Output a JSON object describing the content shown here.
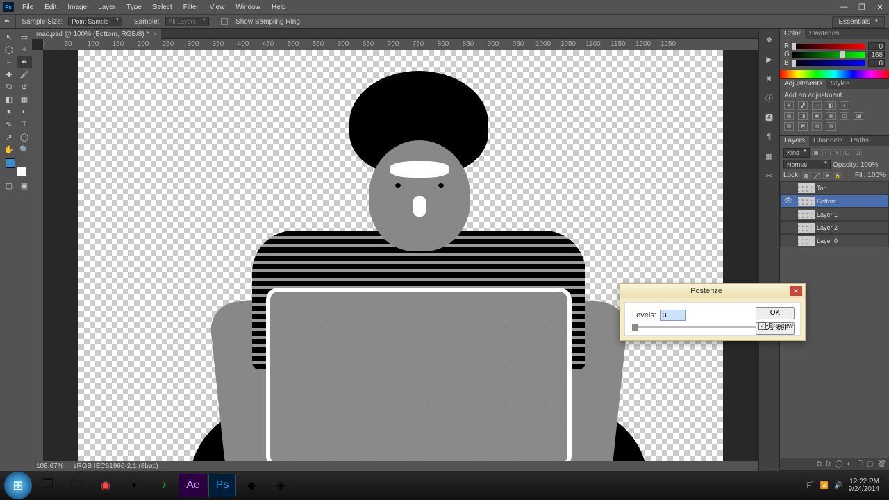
{
  "menu": {
    "items": [
      "File",
      "Edit",
      "Image",
      "Layer",
      "Type",
      "Select",
      "Filter",
      "View",
      "Window",
      "Help"
    ]
  },
  "window": {
    "min": "—",
    "max": "❐",
    "close": "✕",
    "essentials": "Essentials"
  },
  "options": {
    "sample_size_label": "Sample Size:",
    "sample_size_value": "Point Sample",
    "sample_label": "Sample:",
    "sample_value": "All Layers",
    "show_ring": "Show Sampling Ring"
  },
  "tab": {
    "title": "mac.psd @ 100% (Bottom, RGB/8) *",
    "close": "×"
  },
  "ruler": {
    "marks": [
      "0",
      "50",
      "100",
      "150",
      "200",
      "250",
      "300",
      "350",
      "400",
      "450",
      "500",
      "550",
      "600",
      "650",
      "700",
      "750",
      "800",
      "850",
      "900",
      "950",
      "1000",
      "1050",
      "1100",
      "1150",
      "1200",
      "1250"
    ]
  },
  "status": {
    "zoom": "108.67%",
    "profile": "sRGB IEC61966-2.1 (8bpc)"
  },
  "colorPanel": {
    "tab1": "Color",
    "tab2": "Swatches",
    "r": "R",
    "g": "G",
    "b": "B",
    "rv": "0",
    "gv": "168",
    "bv": "0"
  },
  "adjPanel": {
    "tab1": "Adjustments",
    "tab2": "Styles",
    "title": "Add an adjustment"
  },
  "layersPanel": {
    "tabs": [
      "Layers",
      "Channels",
      "Paths"
    ],
    "kind": "Kind",
    "mode": "Normal",
    "opacity_label": "Opacity:",
    "opacity": "100%",
    "lock": "Lock:",
    "fill_label": "Fill:",
    "fill": "100%",
    "layers": [
      {
        "name": "Top",
        "sel": false,
        "vis": false
      },
      {
        "name": "Bottom",
        "sel": true,
        "vis": true
      },
      {
        "name": "Layer 1",
        "sel": false,
        "vis": false
      },
      {
        "name": "Layer 2",
        "sel": false,
        "vis": false
      },
      {
        "name": "Layer 0",
        "sel": false,
        "vis": false
      }
    ]
  },
  "dialog": {
    "title": "Posterize",
    "levels_label": "Levels:",
    "levels_value": "3",
    "ok": "OK",
    "cancel": "Cancel",
    "preview": "Preview"
  },
  "taskbar": {
    "time": "12:22 PM",
    "date": "9/24/2014"
  }
}
